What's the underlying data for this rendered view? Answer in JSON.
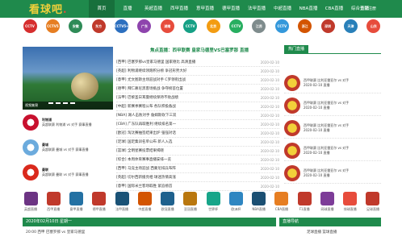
{
  "header": {
    "logo_text": "看球吧",
    "nav": [
      "首页",
      "直播",
      "英超直播",
      "西甲直播",
      "意甲直播",
      "德甲直播",
      "法甲直播",
      "中超直播",
      "NBA直播",
      "CBA直播",
      "综合直播"
    ],
    "login": "登录注册"
  },
  "tv_channels": [
    {
      "label": "CCTV",
      "color": "#d62e2e"
    },
    {
      "label": "CCTV5",
      "color": "#e67e22"
    },
    {
      "label": "安徽",
      "color": "#2e8b57"
    },
    {
      "label": "东方",
      "color": "#c0392b"
    },
    {
      "label": "CCTV5+",
      "color": "#2c6fbf"
    },
    {
      "label": "广东",
      "color": "#8e44ad"
    },
    {
      "label": "湖南",
      "color": "#e74c3c"
    },
    {
      "label": "CCTV",
      "color": "#16a085"
    },
    {
      "label": "北京",
      "color": "#f39c12"
    },
    {
      "label": "CCTV",
      "color": "#27ae60"
    },
    {
      "label": "江苏",
      "color": "#7f8c8d"
    },
    {
      "label": "CCTV",
      "color": "#3498db"
    },
    {
      "label": "浙江",
      "color": "#d35400"
    },
    {
      "label": "深圳",
      "color": "#c0392b"
    },
    {
      "label": "天津",
      "color": "#2980b9"
    },
    {
      "label": "山东",
      "color": "#e74c3c"
    }
  ],
  "banner": {
    "caption": "视频集锦"
  },
  "headline": "焦点直播：西甲联赛 皇家马德里VS巴塞罗那 直播",
  "left_matches": [
    {
      "title": "利物浦",
      "desc": "英超联赛 利物浦 vs 对手 赛事直播"
    },
    {
      "title": "曼城",
      "desc": "英超联赛 曼城 vs 对手 赛事直播"
    },
    {
      "title": "曼联",
      "desc": "英超联赛 曼联 vs 对手 赛事直播"
    }
  ],
  "news": [
    {
      "t": "[西甲] 巴塞罗那vs皇家马德里 国家德比 高清直播",
      "d": "2020-02-10"
    },
    {
      "t": "[英超] 利物浦继续领跑积分榜 争冠形势大好",
      "d": "2020-02-10"
    },
    {
      "t": "[意甲] 尤文图斯主场迎战对手 C罗领衔出战",
      "d": "2020-02-10"
    },
    {
      "t": "[德甲] 拜仁慕尼黑客场挑战 争夺榜首位置",
      "d": "2020-02-10"
    },
    {
      "t": "[法甲] 巴黎圣日耳曼继续保持不败战绩",
      "d": "2020-02-10"
    },
    {
      "t": "[中超] 新赛季赛程公布 各队积极备战",
      "d": "2020-02-10"
    },
    {
      "t": "[NBA] 湖人击败对手 詹姆斯砍下三双",
      "d": "2020-02-10"
    },
    {
      "t": "[CBA] 广东队再取胜利 继续排名第一",
      "d": "2020-02-10"
    },
    {
      "t": "[欧冠] 淘汰赛抽签结果出炉 强强对话",
      "d": "2020-02-10"
    },
    {
      "t": "[足球] 国足集训名单公布 新人入选",
      "d": "2020-02-10"
    },
    {
      "t": "[篮球] 全明星赛投票结果揭晓",
      "d": "2020-02-10"
    },
    {
      "t": "[综合] 本周体育赛事直播安排一览",
      "d": "2020-02-10"
    },
    {
      "t": "[西甲] 马竞主场迎战 西蒙尼排兵布阵",
      "d": "2020-02-10"
    },
    {
      "t": "[英超] 切尔西新援亮相 球迷热情高涨",
      "d": "2020-02-10"
    },
    {
      "t": "[意甲] 国际米兰客场取胜 紧追榜首",
      "d": "2020-02-10"
    }
  ],
  "right_title": "热门直播",
  "right_matches": [
    {
      "line1": "西甲联赛 比利亚雷亚尔 vs 对手",
      "line2": "2020-02-10 直播"
    },
    {
      "line1": "西甲联赛 比利亚雷亚尔 vs 对手",
      "line2": "2020-02-10 直播"
    },
    {
      "line1": "西甲联赛 比利亚雷亚尔 vs 对手",
      "line2": "2020-02-10 直播"
    },
    {
      "line1": "西甲联赛 比利亚雷亚尔 vs 对手",
      "line2": "2020-02-10 直播"
    },
    {
      "line1": "西甲联赛 比利亚雷亚尔 vs 对手",
      "line2": "2020-02-10 直播"
    }
  ],
  "leagues": [
    {
      "label": "英超直播",
      "color": "#6c3483"
    },
    {
      "label": "西甲直播",
      "color": "#c0392b"
    },
    {
      "label": "意甲直播",
      "color": "#2471a3"
    },
    {
      "label": "德甲直播",
      "color": "#c0392b"
    },
    {
      "label": "法甲直播",
      "color": "#1a5276"
    },
    {
      "label": "中超直播",
      "color": "#d35400"
    },
    {
      "label": "欧冠直播",
      "color": "#1f618d"
    },
    {
      "label": "亚冠直播",
      "color": "#b9770e"
    },
    {
      "label": "世界杯",
      "color": "#17a589"
    },
    {
      "label": "欧洲杯",
      "color": "#2e86c1"
    },
    {
      "label": "NBA直播",
      "color": "#1b4f72"
    },
    {
      "label": "CBA直播",
      "color": "#e67e22"
    },
    {
      "label": "F1直播",
      "color": "#c0392b"
    },
    {
      "label": "网球直播",
      "color": "#7d3c98"
    },
    {
      "label": "排球直播",
      "color": "#e74c3c"
    },
    {
      "label": "足球直播",
      "color": "#c0392b"
    }
  ],
  "bottom": {
    "title": "2020年02月10日 星期一",
    "row": "20:00 西甲 巴塞罗那 vs 皇家马德里",
    "side_title": "直播导航",
    "side_row": "足球直播 篮球直播"
  }
}
